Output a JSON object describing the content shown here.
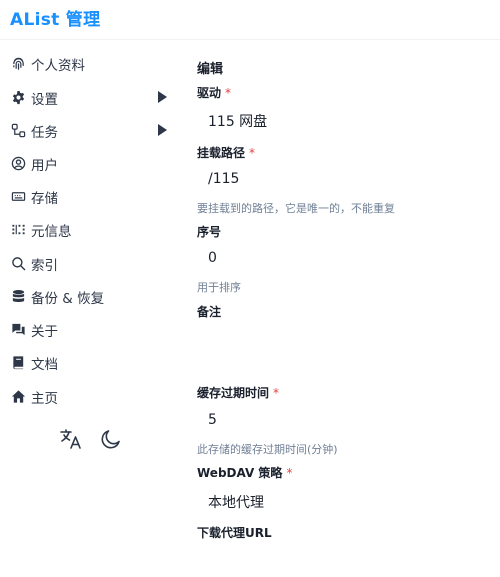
{
  "app": {
    "title": "AList 管理"
  },
  "sidebar": {
    "items": [
      {
        "label": "个人资料",
        "icon": "fingerprint-icon"
      },
      {
        "label": "设置",
        "icon": "gear-icon",
        "has_submenu": true
      },
      {
        "label": "任务",
        "icon": "tasks-icon",
        "has_submenu": true
      },
      {
        "label": "用户",
        "icon": "user-icon"
      },
      {
        "label": "存储",
        "icon": "storage-icon"
      },
      {
        "label": "元信息",
        "icon": "metadata-icon"
      },
      {
        "label": "索引",
        "icon": "search-icon"
      },
      {
        "label": "备份 & 恢复",
        "icon": "database-icon"
      },
      {
        "label": "关于",
        "icon": "chat-icon"
      },
      {
        "label": "文档",
        "icon": "book-icon"
      },
      {
        "label": "主页",
        "icon": "home-icon"
      }
    ],
    "tools": [
      {
        "name": "language-icon"
      },
      {
        "name": "moon-icon"
      }
    ]
  },
  "form": {
    "title": "编辑",
    "driver": {
      "label": "驱动",
      "required": "*",
      "value": "115 网盘"
    },
    "mount_path": {
      "label": "挂载路径",
      "required": "*",
      "value": "/115",
      "help": "要挂载到的路径，它是唯一的，不能重复"
    },
    "order": {
      "label": "序号",
      "value": "0",
      "help": "用于排序"
    },
    "remark": {
      "label": "备注",
      "value": ""
    },
    "cache_expiration": {
      "label": "缓存过期时间",
      "required": "*",
      "value": "5",
      "help": "此存储的缓存过期时间(分钟)"
    },
    "webdav_policy": {
      "label": "WebDAV 策略",
      "required": "*",
      "value": "本地代理"
    },
    "download_proxy_url": {
      "label": "下载代理URL",
      "value": ""
    }
  },
  "colors": {
    "brand": "#1890ff",
    "required": "#e53e3e",
    "help_text": "#718096",
    "icon": "#2d3748"
  }
}
